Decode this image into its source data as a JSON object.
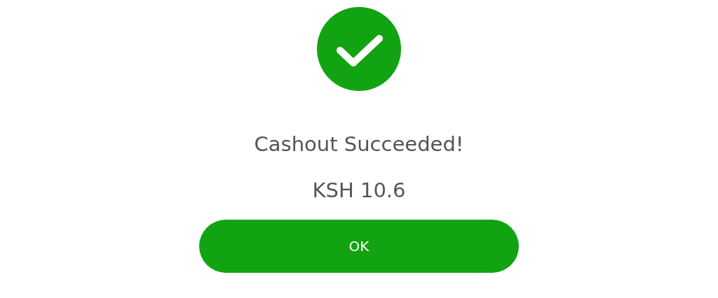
{
  "status": {
    "kind": "success"
  },
  "title": "Cashout Succeeded!",
  "amount": "KSH 10.6",
  "button": {
    "label": "OK"
  }
}
